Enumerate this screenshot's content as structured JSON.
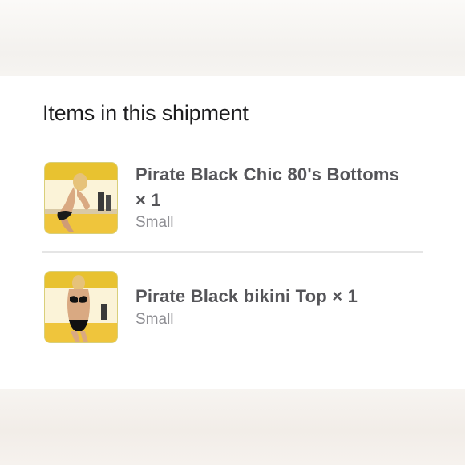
{
  "section": {
    "title": "Items in this shipment"
  },
  "items": [
    {
      "name": "Pirate Black Chic 80's Bottoms × 1",
      "variant": "Small",
      "thumbnail_icon": "product-photo-bottoms"
    },
    {
      "name": "Pirate Black bikini Top × 1",
      "variant": "Small",
      "thumbnail_icon": "product-photo-top"
    }
  ],
  "colors": {
    "title_text": "#1d1d1f",
    "item_name_text": "#555559",
    "variant_text": "#8e8e93",
    "divider": "#e5e5e5",
    "thumbnail_background": "#f3d24a"
  }
}
